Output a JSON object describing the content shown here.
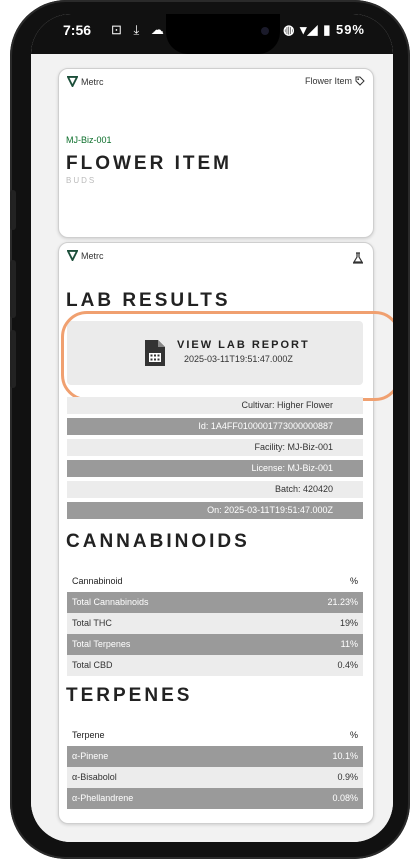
{
  "status": {
    "time": "7:56",
    "left_icons": "⊡ ⤓ ☁",
    "right_icons": "◍ ▾◢",
    "battery": "59%"
  },
  "flower_card": {
    "brand": "Metrc",
    "type_label": "Flower Item",
    "license": "MJ-Biz-001",
    "title": "FLOWER ITEM",
    "subtitle": "BUDS"
  },
  "lab_card": {
    "brand": "Metrc",
    "title": "LAB RESULTS",
    "report_button": {
      "label": "VIEW LAB REPORT",
      "date": "2025-03-11T19:51:47.000Z"
    },
    "meta": [
      {
        "text": "Cultivar: Higher Flower",
        "shade": "light"
      },
      {
        "text": "Id: 1A4FF0100001773000000887",
        "shade": "dark"
      },
      {
        "text": "Facility: MJ-Biz-001",
        "shade": "light"
      },
      {
        "text": "License: MJ-Biz-001",
        "shade": "dark"
      },
      {
        "text": "Batch: 420420",
        "shade": "light"
      },
      {
        "text": "On: 2025-03-11T19:51:47.000Z",
        "shade": "dark"
      }
    ],
    "cannabinoids": {
      "title": "CANNABINOIDS",
      "headers": [
        "Cannabinoid",
        "%"
      ],
      "rows": [
        {
          "name": "Total Cannabinoids",
          "value": "21.23%",
          "shade": "dark"
        },
        {
          "name": "Total THC",
          "value": "19%",
          "shade": "light"
        },
        {
          "name": "Total Terpenes",
          "value": "11%",
          "shade": "dark"
        },
        {
          "name": "Total CBD",
          "value": "0.4%",
          "shade": "light"
        }
      ]
    },
    "terpenes": {
      "title": "TERPENES",
      "headers": [
        "Terpene",
        "%"
      ],
      "rows": [
        {
          "name": "α-Pinene",
          "value": "10.1%",
          "shade": "dark"
        },
        {
          "name": "α-Bisabolol",
          "value": "0.9%",
          "shade": "light"
        },
        {
          "name": "α-Phellandrene",
          "value": "0.08%",
          "shade": "dark"
        }
      ]
    }
  }
}
